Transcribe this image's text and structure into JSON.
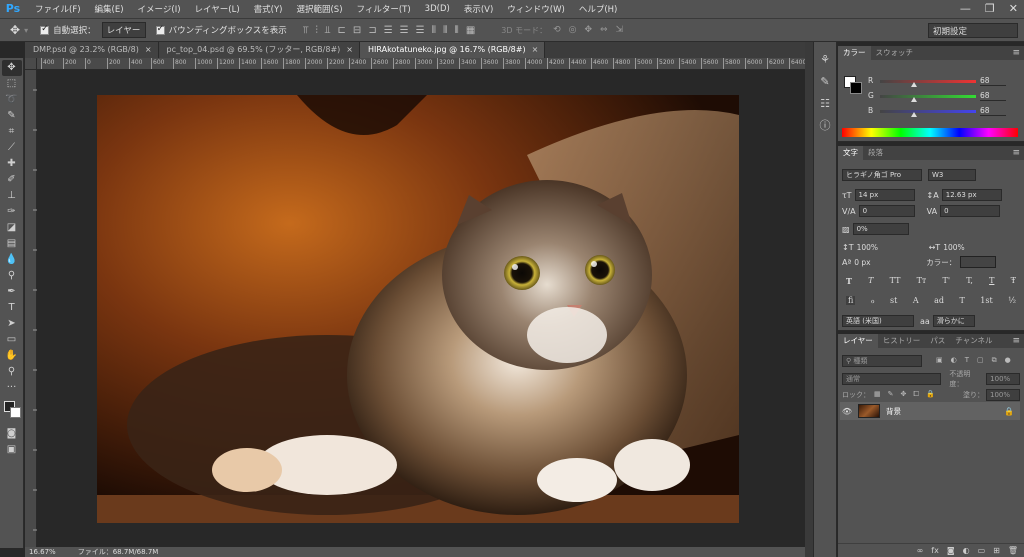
{
  "app": {
    "logo": "Ps"
  },
  "menu": [
    "ファイル(F)",
    "編集(E)",
    "イメージ(I)",
    "レイヤー(L)",
    "書式(Y)",
    "選択範囲(S)",
    "フィルター(T)",
    "3D(D)",
    "表示(V)",
    "ウィンドウ(W)",
    "ヘルプ(H)"
  ],
  "window_controls": {
    "minimize": "—",
    "restore": "❐",
    "close": "✕"
  },
  "options": {
    "auto_select_label": "自動選択：",
    "auto_select_value": "レイヤー",
    "bounding_box_label": "バウンディングボックスを表示",
    "mode_3d_label": "3D モード：",
    "workspace": "初期設定"
  },
  "tabs": [
    {
      "label": "DMP.psd @ 23.2% (RGB/8)",
      "close": "×",
      "active": false
    },
    {
      "label": "pc_top_04.psd @ 69.5% (フッター, RGB/8#)",
      "close": "×",
      "active": false
    },
    {
      "label": "HIRAkotatuneko.jpg @ 16.7% (RGB/8#)",
      "close": "×",
      "active": true
    }
  ],
  "ruler_ticks": [
    "400",
    "200",
    "0",
    "200",
    "400",
    "600",
    "800",
    "1000",
    "1200",
    "1400",
    "1600",
    "1800",
    "2000",
    "2200",
    "2400",
    "2600",
    "2800",
    "3000",
    "3200",
    "3400",
    "3600",
    "3800",
    "4000",
    "4200",
    "4400",
    "4600",
    "4800",
    "5000",
    "5200",
    "5400",
    "5600",
    "5800",
    "6000",
    "6200",
    "6400"
  ],
  "status": {
    "zoom": "16.67%",
    "file": "ファイル：68.7M/68.7M"
  },
  "color_panel": {
    "tabs": [
      "カラー",
      "スウォッチ"
    ],
    "sliders": [
      {
        "label": "R",
        "value": "68"
      },
      {
        "label": "G",
        "value": "68"
      },
      {
        "label": "B",
        "value": "68"
      }
    ]
  },
  "char_panel": {
    "tabs": [
      "文字",
      "段落"
    ],
    "font_family": "ヒラギノ角ゴ Pro",
    "font_weight": "W3",
    "size": "14 px",
    "leading": "12.63 px",
    "kerning": "0",
    "tracking": "0",
    "tsume": "0%",
    "vscale": "100%",
    "hscale": "100%",
    "baseline": "0 px",
    "color_label": "カラー：",
    "styles": [
      "T",
      "T",
      "TT",
      "Tт",
      "T'",
      "T,",
      "T",
      "Ŧ"
    ],
    "opentype": [
      "fi",
      "ℴ",
      "st",
      "A",
      "ad",
      "T",
      "1st",
      "½"
    ],
    "language": "英語 (米国)",
    "aa_icon": "aa",
    "antialias": "滑らかに"
  },
  "layers_panel": {
    "tabs": [
      "レイヤー",
      "ヒストリー",
      "パス",
      "チャンネル"
    ],
    "kind_filter": "種類",
    "blend_mode": "通常",
    "opacity_label": "不透明度：",
    "opacity_value": "100%",
    "lock_label": "ロック：",
    "fill_label": "塗り：",
    "fill_value": "100%",
    "layer_name": "背景"
  },
  "chart_colors": {
    "accent": "#31a8ff",
    "bg": "#535353"
  }
}
